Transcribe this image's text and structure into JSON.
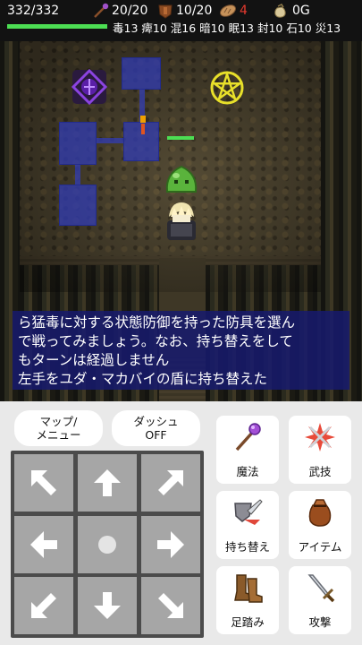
{
  "status": {
    "hp": "332/332",
    "hp_ratio": 1.0,
    "weapon_uses": "20/20",
    "shield_uses": "10/20",
    "food": "4",
    "gold": "0G",
    "resistances": [
      "毒13",
      "痺10",
      "混16",
      "暗10",
      "眠13",
      "封10",
      "石10",
      "災13"
    ],
    "icons": [
      "staff-icon",
      "shield-icon",
      "bread-icon",
      "coin-bag-icon"
    ]
  },
  "dungeon": {
    "colors": {
      "floor": "#463e2b",
      "minimap": "#3c46b4",
      "slime": "#5ab33c",
      "hp_indicator": "#4cde53"
    }
  },
  "message": {
    "lines": [
      "ら猛毒に対する状態防御を持った防具を選ん",
      "で戦ってみましょう。なお、持ち替えをして",
      "もターンは経過しません",
      "左手をユダ・マカバイの盾に持ち替えた"
    ]
  },
  "controls": {
    "map_menu": "マップ/\nメニュー",
    "dash": "ダッシュ\nOFF",
    "dpad": [
      "up-left-arrow",
      "up-arrow",
      "up-right-arrow",
      "left-arrow",
      "center-wait",
      "right-arrow",
      "down-left-arrow",
      "down-arrow",
      "down-right-arrow"
    ],
    "actions": {
      "magic": "魔法",
      "martial": "武技",
      "swap": "持ち替え",
      "item": "アイテム",
      "step": "足踏み",
      "attack": "攻撃"
    }
  }
}
